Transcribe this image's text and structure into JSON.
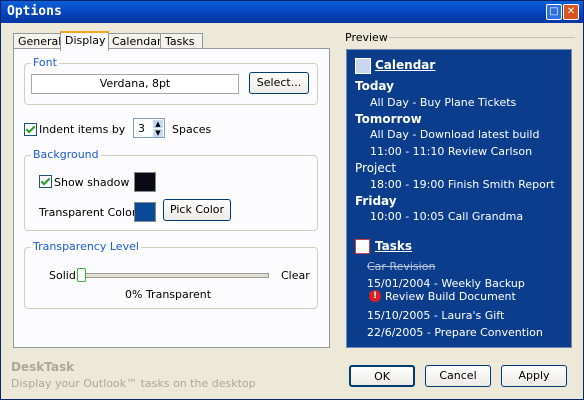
{
  "window": {
    "title": "Options",
    "restore_icon": "restore-icon",
    "close_icon": "close-icon"
  },
  "tabs": [
    {
      "label": "General",
      "active": false
    },
    {
      "label": "Display",
      "active": true
    },
    {
      "label": "Calendar",
      "active": false
    },
    {
      "label": "Tasks",
      "active": false
    }
  ],
  "font": {
    "group_title": "Font",
    "value": "Verdana, 8pt",
    "select_label": "Select..."
  },
  "indent": {
    "checkbox_label": "Indent items by",
    "checked": true,
    "value": "3",
    "unit_label": "Spaces"
  },
  "background": {
    "group_title": "Background",
    "shadow_label": "Show shadow :",
    "shadow_checked": true,
    "shadow_color": "#0a0a14",
    "transparent_label": "Transparent Color:",
    "transparent_color": "#0b4a98",
    "pick_color_label": "Pick Color"
  },
  "transparency": {
    "group_title": "Transparency Level",
    "left_label": "Solid",
    "right_label": "Clear",
    "value": 0,
    "status": "0% Transparent"
  },
  "preview": {
    "label": "Preview",
    "calendar_title": "Calendar",
    "calendar_icon": "calendar-icon",
    "day_today": "Today",
    "today_1": "All Day - Buy Plane Tickets",
    "day_tomorrow": "Tomorrow",
    "tomorrow_1": "All Day - Download latest build",
    "tomorrow_2": "11:00 - 11:10 Review Carlson",
    "day_project": "Project",
    "project_1": "18:00 - 19:00 Finish Smith Report",
    "day_friday": "Friday",
    "friday_1": "10:00 - 10:05 Call Grandma",
    "tasks_title": "Tasks",
    "tasks_icon": "tasks-icon",
    "task_1": "Car Revision",
    "task_2": "15/01/2004 - Weekly Backup",
    "task_3": "Review Build Document",
    "task_4": "15/10/2005 - Laura's Gift",
    "task_5": "22/6/2005 - Prepare Convention",
    "bg_color": "#0b3d8c"
  },
  "footer": {
    "app_name": "DeskTask",
    "tagline": "Display your Outlook™ tasks on the desktop",
    "ok_label": "OK",
    "cancel_label": "Cancel",
    "apply_label": "Apply"
  }
}
